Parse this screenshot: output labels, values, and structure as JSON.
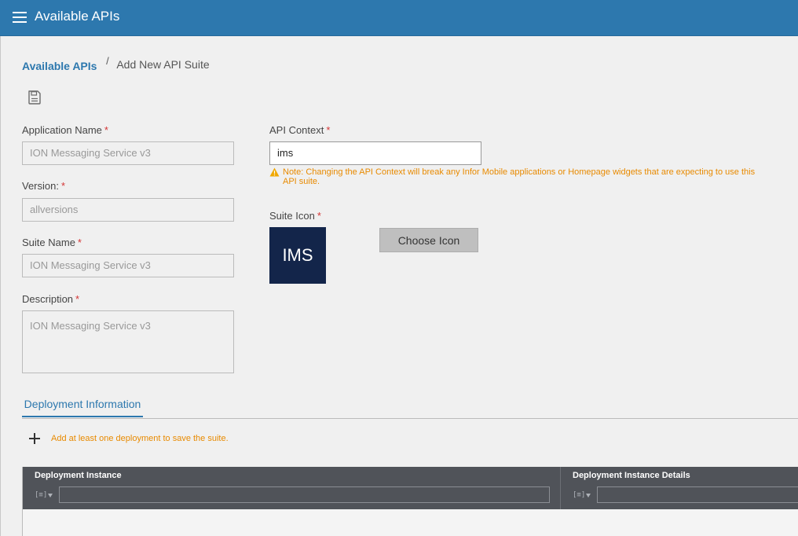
{
  "header": {
    "title": "Available APIs",
    "menu_icon": "hamburger-menu-icon"
  },
  "breadcrumb": {
    "parent": "Available APIs",
    "separator": "/",
    "current": "Add New API Suite"
  },
  "toolbar": {
    "save_icon": "save-icon"
  },
  "form": {
    "application_name": {
      "label": "Application Name",
      "required": "*",
      "value": "ION Messaging Service v3"
    },
    "version": {
      "label": "Version:",
      "required": "*",
      "value": "allversions"
    },
    "suite_name": {
      "label": "Suite Name",
      "required": "*",
      "value": "ION Messaging Service v3"
    },
    "description": {
      "label": "Description",
      "required": "*",
      "value": "ION Messaging Service v3"
    },
    "api_context": {
      "label": "API Context",
      "required": "*",
      "value": "ims",
      "note": "Note: Changing the API Context will break any Infor Mobile applications or Homepage widgets that are expecting to use this API suite.",
      "note_icon": "warning-icon"
    },
    "suite_icon": {
      "label": "Suite Icon",
      "required": "*",
      "preview_text": "IMS",
      "button_label": "Choose Icon"
    }
  },
  "tabs": [
    {
      "label": "Deployment Information",
      "active": true
    }
  ],
  "deployment": {
    "add_icon": "plus-icon",
    "hint": "Add at least one deployment to save the suite.",
    "columns": [
      {
        "title": "Deployment Instance",
        "filter_icon": "filter-icon",
        "filter_value": ""
      },
      {
        "title": "Deployment Instance Details",
        "filter_icon": "filter-icon",
        "filter_value": ""
      }
    ]
  },
  "colors": {
    "header_bg": "#2d78ae",
    "link": "#2d78ae",
    "required": "#d43636",
    "warning": "#e88a00",
    "suite_icon_bg": "#13254a",
    "grid_header_bg": "#505359"
  }
}
